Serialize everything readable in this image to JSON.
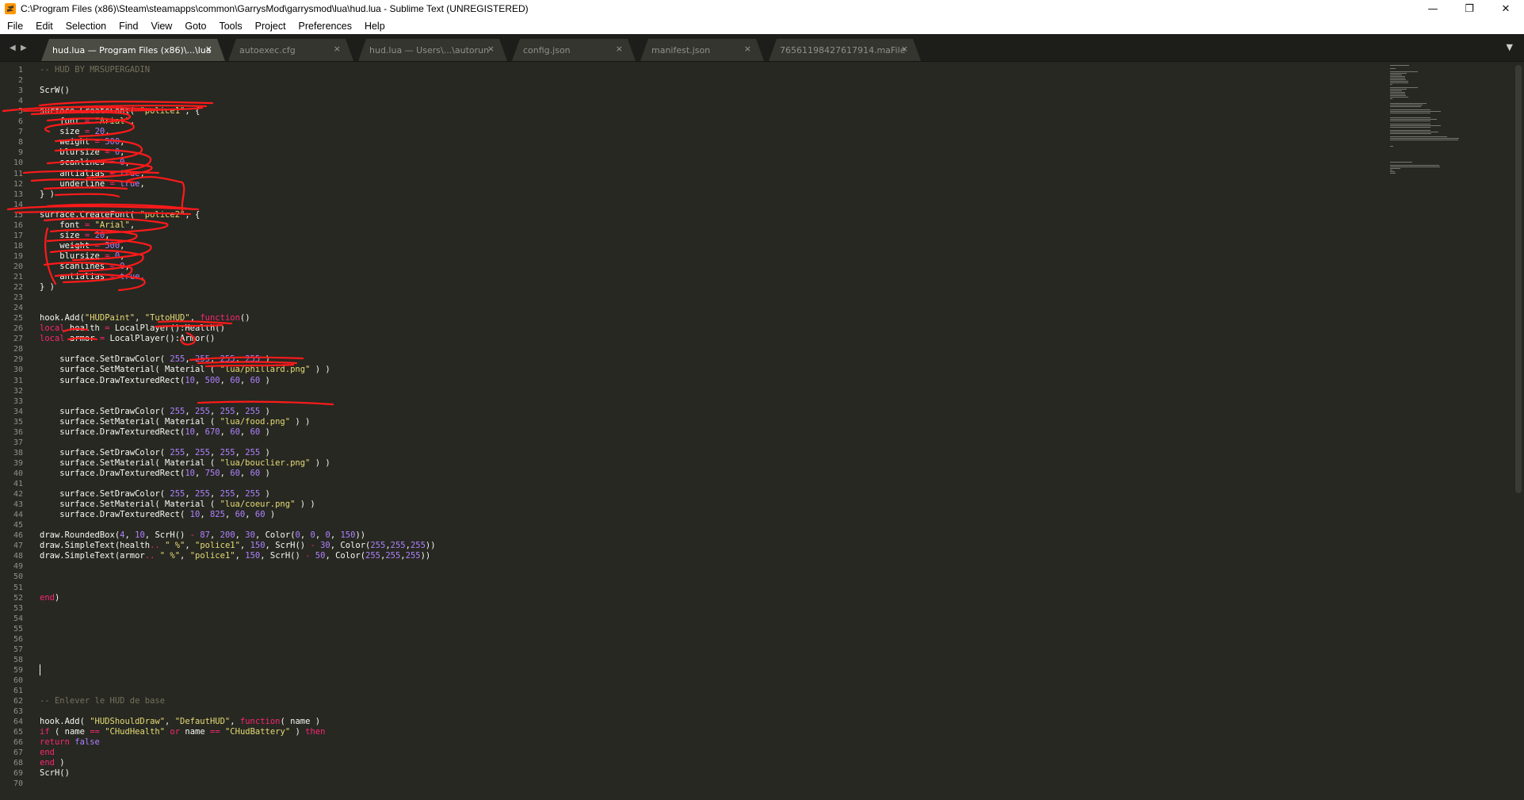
{
  "window": {
    "title": "C:\\Program Files (x86)\\Steam\\steamapps\\common\\GarrysMod\\garrysmod\\lua\\hud.lua - Sublime Text (UNREGISTERED)",
    "minimize": "—",
    "maximize": "❐",
    "close": "✕"
  },
  "menu": [
    "File",
    "Edit",
    "Selection",
    "Find",
    "View",
    "Goto",
    "Tools",
    "Project",
    "Preferences",
    "Help"
  ],
  "tabs": [
    {
      "label": "hud.lua — Program Files (x86)\\...\\lua",
      "active": true
    },
    {
      "label": "autoexec.cfg",
      "active": false
    },
    {
      "label": "hud.lua — Users\\...\\autorun",
      "active": false
    },
    {
      "label": "config.json",
      "active": false
    },
    {
      "label": "manifest.json",
      "active": false
    },
    {
      "label": "76561198427617914.maFile",
      "active": false
    }
  ],
  "tab_close_glyph": "×",
  "tab_nav": {
    "prev": "◀",
    "next": "▶",
    "dropdown": "▼"
  },
  "editor": {
    "cursor_line": 59,
    "lines": [
      [
        [
          "com",
          "-- HUD BY MRSUPERGADIN"
        ]
      ],
      [],
      [
        [
          "tx",
          "ScrW()"
        ]
      ],
      [],
      [
        [
          "tx",
          "surface.CreateFont( "
        ],
        [
          "str",
          "\"police1\""
        ],
        [
          "tx",
          ", {"
        ]
      ],
      [
        [
          "tx",
          "    font "
        ],
        [
          "op",
          "="
        ],
        [
          "tx",
          " "
        ],
        [
          "str",
          "\"Arial\""
        ],
        [
          "tx",
          ","
        ]
      ],
      [
        [
          "tx",
          "    size "
        ],
        [
          "op",
          "="
        ],
        [
          "tx",
          " "
        ],
        [
          "num",
          "20"
        ],
        [
          "tx",
          ","
        ]
      ],
      [
        [
          "tx",
          "    weight "
        ],
        [
          "op",
          "="
        ],
        [
          "tx",
          " "
        ],
        [
          "num",
          "500"
        ],
        [
          "tx",
          ","
        ]
      ],
      [
        [
          "tx",
          "    blursize "
        ],
        [
          "op",
          "="
        ],
        [
          "tx",
          " "
        ],
        [
          "num",
          "0"
        ],
        [
          "tx",
          ","
        ]
      ],
      [
        [
          "tx",
          "    scanlines "
        ],
        [
          "op",
          "="
        ],
        [
          "tx",
          " "
        ],
        [
          "num",
          "0"
        ],
        [
          "tx",
          ","
        ]
      ],
      [
        [
          "tx",
          "    antialias "
        ],
        [
          "op",
          "="
        ],
        [
          "tx",
          " "
        ],
        [
          "num",
          "true"
        ],
        [
          "tx",
          ","
        ]
      ],
      [
        [
          "tx",
          "    underline "
        ],
        [
          "op",
          "="
        ],
        [
          "tx",
          " "
        ],
        [
          "num",
          "true"
        ],
        [
          "tx",
          ","
        ]
      ],
      [
        [
          "tx",
          "} )"
        ]
      ],
      [],
      [
        [
          "tx",
          "surface.CreateFont( "
        ],
        [
          "str",
          "\"police2\""
        ],
        [
          "tx",
          ", {"
        ]
      ],
      [
        [
          "tx",
          "    font "
        ],
        [
          "op",
          "="
        ],
        [
          "tx",
          " "
        ],
        [
          "str",
          "\"Arial\""
        ],
        [
          "tx",
          ","
        ]
      ],
      [
        [
          "tx",
          "    size "
        ],
        [
          "op",
          "="
        ],
        [
          "tx",
          " "
        ],
        [
          "num",
          "20"
        ],
        [
          "tx",
          ","
        ]
      ],
      [
        [
          "tx",
          "    weight "
        ],
        [
          "op",
          "="
        ],
        [
          "tx",
          " "
        ],
        [
          "num",
          "500"
        ],
        [
          "tx",
          ","
        ]
      ],
      [
        [
          "tx",
          "    blursize "
        ],
        [
          "op",
          "="
        ],
        [
          "tx",
          " "
        ],
        [
          "num",
          "0"
        ],
        [
          "tx",
          ","
        ]
      ],
      [
        [
          "tx",
          "    scanlines "
        ],
        [
          "op",
          "="
        ],
        [
          "tx",
          " "
        ],
        [
          "num",
          "0"
        ],
        [
          "tx",
          ","
        ]
      ],
      [
        [
          "tx",
          "    antialias "
        ],
        [
          "op",
          "="
        ],
        [
          "tx",
          " "
        ],
        [
          "num",
          "true"
        ],
        [
          "tx",
          ","
        ]
      ],
      [
        [
          "tx",
          "} )"
        ]
      ],
      [],
      [],
      [
        [
          "tx",
          "hook.Add("
        ],
        [
          "str",
          "\"HUDPaint\""
        ],
        [
          "tx",
          ", "
        ],
        [
          "str",
          "\"TutoHUD\""
        ],
        [
          "tx",
          ", "
        ],
        [
          "kw",
          "function"
        ],
        [
          "tx",
          "()"
        ]
      ],
      [
        [
          "kw",
          "local"
        ],
        [
          "tx",
          " health "
        ],
        [
          "op",
          "="
        ],
        [
          "tx",
          " LocalPlayer():Health()"
        ]
      ],
      [
        [
          "kw",
          "local"
        ],
        [
          "tx",
          " armor "
        ],
        [
          "op",
          "="
        ],
        [
          "tx",
          " LocalPlayer():Armor()"
        ]
      ],
      [],
      [
        [
          "tx",
          "    surface.SetDrawColor( "
        ],
        [
          "num",
          "255"
        ],
        [
          "tx",
          ", "
        ],
        [
          "num",
          "255"
        ],
        [
          "tx",
          ", "
        ],
        [
          "num",
          "255"
        ],
        [
          "tx",
          ", "
        ],
        [
          "num",
          "255"
        ],
        [
          "tx",
          " )"
        ]
      ],
      [
        [
          "tx",
          "    surface.SetMaterial( Material ( "
        ],
        [
          "str",
          "\"lua/phillard.png\""
        ],
        [
          "tx",
          " ) )"
        ]
      ],
      [
        [
          "tx",
          "    surface.DrawTexturedRect("
        ],
        [
          "num",
          "10"
        ],
        [
          "tx",
          ", "
        ],
        [
          "num",
          "500"
        ],
        [
          "tx",
          ", "
        ],
        [
          "num",
          "60"
        ],
        [
          "tx",
          ", "
        ],
        [
          "num",
          "60"
        ],
        [
          "tx",
          " )"
        ]
      ],
      [],
      [],
      [
        [
          "tx",
          "    surface.SetDrawColor( "
        ],
        [
          "num",
          "255"
        ],
        [
          "tx",
          ", "
        ],
        [
          "num",
          "255"
        ],
        [
          "tx",
          ", "
        ],
        [
          "num",
          "255"
        ],
        [
          "tx",
          ", "
        ],
        [
          "num",
          "255"
        ],
        [
          "tx",
          " )"
        ]
      ],
      [
        [
          "tx",
          "    surface.SetMaterial( Material ( "
        ],
        [
          "str",
          "\"lua/food.png\""
        ],
        [
          "tx",
          " ) )"
        ]
      ],
      [
        [
          "tx",
          "    surface.DrawTexturedRect("
        ],
        [
          "num",
          "10"
        ],
        [
          "tx",
          ", "
        ],
        [
          "num",
          "670"
        ],
        [
          "tx",
          ", "
        ],
        [
          "num",
          "60"
        ],
        [
          "tx",
          ", "
        ],
        [
          "num",
          "60"
        ],
        [
          "tx",
          " )"
        ]
      ],
      [],
      [
        [
          "tx",
          "    surface.SetDrawColor( "
        ],
        [
          "num",
          "255"
        ],
        [
          "tx",
          ", "
        ],
        [
          "num",
          "255"
        ],
        [
          "tx",
          ", "
        ],
        [
          "num",
          "255"
        ],
        [
          "tx",
          ", "
        ],
        [
          "num",
          "255"
        ],
        [
          "tx",
          " )"
        ]
      ],
      [
        [
          "tx",
          "    surface.SetMaterial( Material ( "
        ],
        [
          "str",
          "\"lua/bouclier.png\""
        ],
        [
          "tx",
          " ) )"
        ]
      ],
      [
        [
          "tx",
          "    surface.DrawTexturedRect("
        ],
        [
          "num",
          "10"
        ],
        [
          "tx",
          ", "
        ],
        [
          "num",
          "750"
        ],
        [
          "tx",
          ", "
        ],
        [
          "num",
          "60"
        ],
        [
          "tx",
          ", "
        ],
        [
          "num",
          "60"
        ],
        [
          "tx",
          " )"
        ]
      ],
      [],
      [
        [
          "tx",
          "    surface.SetDrawColor( "
        ],
        [
          "num",
          "255"
        ],
        [
          "tx",
          ", "
        ],
        [
          "num",
          "255"
        ],
        [
          "tx",
          ", "
        ],
        [
          "num",
          "255"
        ],
        [
          "tx",
          ", "
        ],
        [
          "num",
          "255"
        ],
        [
          "tx",
          " )"
        ]
      ],
      [
        [
          "tx",
          "    surface.SetMaterial( Material ( "
        ],
        [
          "str",
          "\"lua/coeur.png\""
        ],
        [
          "tx",
          " ) )"
        ]
      ],
      [
        [
          "tx",
          "    surface.DrawTexturedRect( "
        ],
        [
          "num",
          "10"
        ],
        [
          "tx",
          ", "
        ],
        [
          "num",
          "825"
        ],
        [
          "tx",
          ", "
        ],
        [
          "num",
          "60"
        ],
        [
          "tx",
          ", "
        ],
        [
          "num",
          "60"
        ],
        [
          "tx",
          " )"
        ]
      ],
      [],
      [
        [
          "tx",
          "draw.RoundedBox("
        ],
        [
          "num",
          "4"
        ],
        [
          "tx",
          ", "
        ],
        [
          "num",
          "10"
        ],
        [
          "tx",
          ", ScrH() "
        ],
        [
          "op",
          "-"
        ],
        [
          "tx",
          " "
        ],
        [
          "num",
          "87"
        ],
        [
          "tx",
          ", "
        ],
        [
          "num",
          "200"
        ],
        [
          "tx",
          ", "
        ],
        [
          "num",
          "30"
        ],
        [
          "tx",
          ", Color("
        ],
        [
          "num",
          "0"
        ],
        [
          "tx",
          ", "
        ],
        [
          "num",
          "0"
        ],
        [
          "tx",
          ", "
        ],
        [
          "num",
          "0"
        ],
        [
          "tx",
          ", "
        ],
        [
          "num",
          "150"
        ],
        [
          "tx",
          "))"
        ]
      ],
      [
        [
          "tx",
          "draw.SimpleText(health"
        ],
        [
          "op",
          ".."
        ],
        [
          "tx",
          " "
        ],
        [
          "str",
          "\" %\""
        ],
        [
          "tx",
          ", "
        ],
        [
          "str",
          "\"police1\""
        ],
        [
          "tx",
          ", "
        ],
        [
          "num",
          "150"
        ],
        [
          "tx",
          ", ScrH() "
        ],
        [
          "op",
          "-"
        ],
        [
          "tx",
          " "
        ],
        [
          "num",
          "30"
        ],
        [
          "tx",
          ", Color("
        ],
        [
          "num",
          "255"
        ],
        [
          "tx",
          ","
        ],
        [
          "num",
          "255"
        ],
        [
          "tx",
          ","
        ],
        [
          "num",
          "255"
        ],
        [
          "tx",
          "))"
        ]
      ],
      [
        [
          "tx",
          "draw.SimpleText(armor"
        ],
        [
          "op",
          ".."
        ],
        [
          "tx",
          " "
        ],
        [
          "str",
          "\" %\""
        ],
        [
          "tx",
          ", "
        ],
        [
          "str",
          "\"police1\""
        ],
        [
          "tx",
          ", "
        ],
        [
          "num",
          "150"
        ],
        [
          "tx",
          ", ScrH() "
        ],
        [
          "op",
          "-"
        ],
        [
          "tx",
          " "
        ],
        [
          "num",
          "50"
        ],
        [
          "tx",
          ", Color("
        ],
        [
          "num",
          "255"
        ],
        [
          "tx",
          ","
        ],
        [
          "num",
          "255"
        ],
        [
          "tx",
          ","
        ],
        [
          "num",
          "255"
        ],
        [
          "tx",
          "))"
        ]
      ],
      [],
      [],
      [],
      [
        [
          "kw",
          "end"
        ],
        [
          "tx",
          ")"
        ]
      ],
      [],
      [],
      [],
      [],
      [],
      [],
      [],
      [],
      [],
      [
        [
          "com",
          "-- Enlever le HUD de base"
        ]
      ],
      [],
      [
        [
          "tx",
          "hook.Add( "
        ],
        [
          "str",
          "\"HUDShouldDraw\""
        ],
        [
          "tx",
          ", "
        ],
        [
          "str",
          "\"DefautHUD\""
        ],
        [
          "tx",
          ", "
        ],
        [
          "kw",
          "function"
        ],
        [
          "tx",
          "( name )"
        ]
      ],
      [
        [
          "kw",
          "if"
        ],
        [
          "tx",
          " ( name "
        ],
        [
          "op",
          "=="
        ],
        [
          "tx",
          " "
        ],
        [
          "str",
          "\"CHudHealth\""
        ],
        [
          "tx",
          " "
        ],
        [
          "kw",
          "or"
        ],
        [
          "tx",
          " name "
        ],
        [
          "op",
          "=="
        ],
        [
          "tx",
          " "
        ],
        [
          "str",
          "\"CHudBattery\""
        ],
        [
          "tx",
          " ) "
        ],
        [
          "kw",
          "then"
        ]
      ],
      [
        [
          "kw",
          "return"
        ],
        [
          "tx",
          " "
        ],
        [
          "num",
          "false"
        ]
      ],
      [
        [
          "kw",
          "end"
        ]
      ],
      [
        [
          "kw",
          "end"
        ],
        [
          "tx",
          " )"
        ]
      ],
      [
        [
          "tx",
          "ScrH()"
        ]
      ],
      []
    ]
  }
}
